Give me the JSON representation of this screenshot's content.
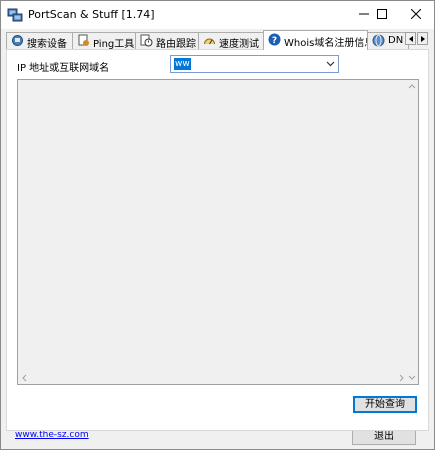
{
  "window": {
    "title": "PortScan & Stuff [1.74]",
    "minimize_glyph": "—",
    "maximize_glyph": "☐",
    "close_glyph": "✕"
  },
  "tabs": [
    {
      "label": "搜索设备",
      "icon": "network-search-icon",
      "active": false
    },
    {
      "label": "Ping工具",
      "icon": "ping-document-icon",
      "active": false
    },
    {
      "label": "路由跟踪",
      "icon": "route-clock-icon",
      "active": false
    },
    {
      "label": "速度测试",
      "icon": "speed-gauge-icon",
      "active": false
    },
    {
      "label": "Whois域名注册信息",
      "icon": "help-question-icon",
      "active": true
    },
    {
      "label": "DN",
      "icon": "dns-globe-icon",
      "active": false
    }
  ],
  "whois": {
    "ip_label": "IP 地址或互联网域名",
    "domain_value": "ww",
    "query_button": "开始查询",
    "output_text": ""
  },
  "footer": {
    "link_text": "www.the-sz.com",
    "exit_button": "退出"
  },
  "colors": {
    "accent": "#0078d7",
    "link": "#0000ff",
    "panel_bg": "#ffffff",
    "window_bg": "#f0f0f0"
  }
}
